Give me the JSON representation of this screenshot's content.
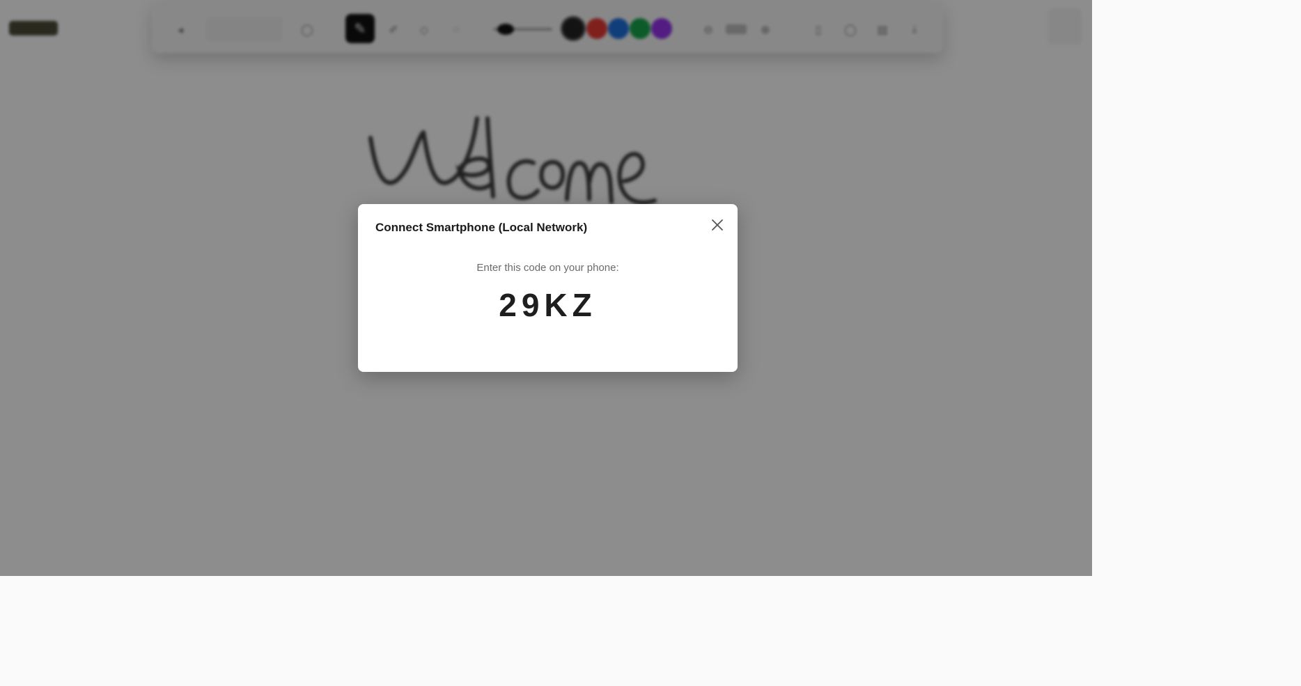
{
  "modal": {
    "title": "Connect Smartphone (Local Network)",
    "prompt": "Enter this code on your phone:",
    "code": "29KZ",
    "close_icon": "close-icon"
  },
  "toolbar": {
    "icons": [
      "back-icon",
      "undo-icon",
      "redo-icon",
      "clock-icon",
      "pen-icon",
      "highlighter-icon",
      "eraser-icon",
      "shape-icon",
      "zoom-out-icon",
      "zoom-in-icon",
      "phone-icon",
      "chat-icon",
      "layers-icon",
      "download-icon"
    ],
    "swatches": [
      "#222222",
      "#e53935",
      "#1e6fdc",
      "#16a34a",
      "#9333ea"
    ]
  },
  "canvas": {
    "ink_color": "#3a3a3a"
  },
  "colors": {
    "overlay": "rgba(0,0,0,0.44)",
    "modal_bg": "#ffffff",
    "code_text": "#1e1e1e"
  }
}
